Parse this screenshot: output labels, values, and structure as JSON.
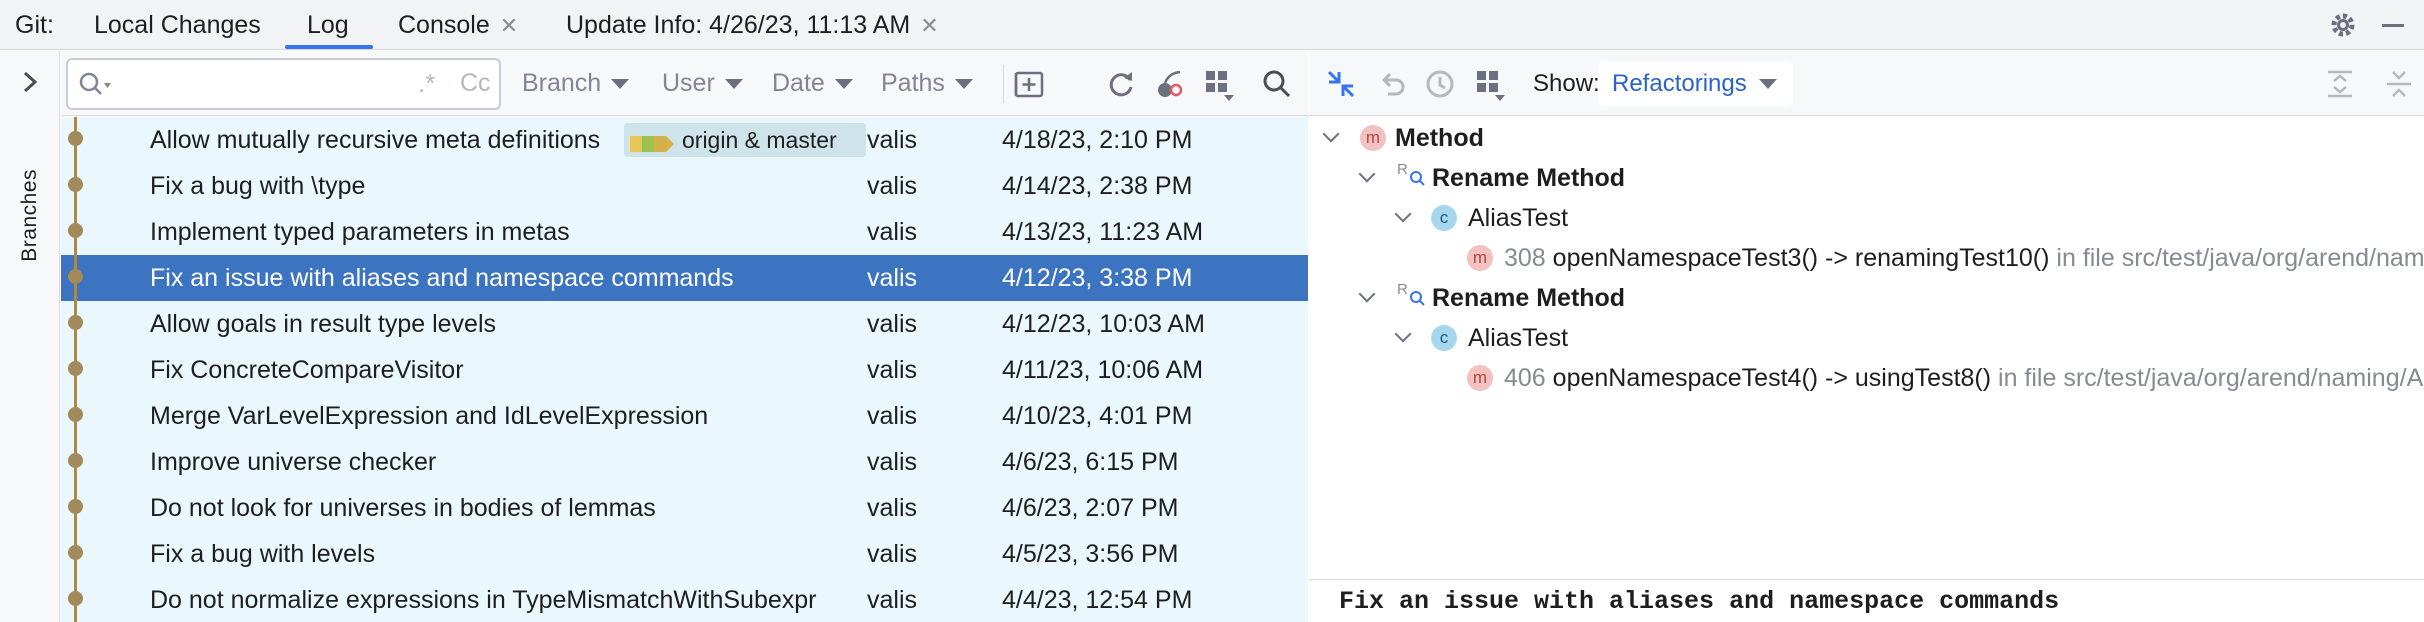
{
  "tabbar": {
    "git_label": "Git:",
    "tabs": [
      {
        "label": "Local Changes"
      },
      {
        "label": "Log"
      },
      {
        "label": "Console"
      },
      {
        "label": "Update Info: 4/26/23, 11:13 AM"
      }
    ],
    "active_tab": "Log"
  },
  "sidebar": {
    "branches_label": "Branches"
  },
  "log": {
    "search": {
      "value": "",
      "placeholder": ""
    },
    "filters": [
      {
        "label": "Branch"
      },
      {
        "label": "User"
      },
      {
        "label": "Date"
      },
      {
        "label": "Paths"
      }
    ],
    "ref_label": "origin & master",
    "commits": [
      {
        "subject": "Allow mutually recursive meta definitions",
        "author": "valis",
        "date": "4/18/23, 2:10 PM"
      },
      {
        "subject": "Fix a bug with \\type",
        "author": "valis",
        "date": "4/14/23, 2:38 PM"
      },
      {
        "subject": "Implement typed parameters in metas",
        "author": "valis",
        "date": "4/13/23, 11:23 AM"
      },
      {
        "subject": "Fix an issue with aliases and namespace commands",
        "author": "valis",
        "date": "4/12/23, 3:38 PM"
      },
      {
        "subject": "Allow goals in result type levels",
        "author": "valis",
        "date": "4/12/23, 10:03 AM"
      },
      {
        "subject": "Fix ConcreteCompareVisitor",
        "author": "valis",
        "date": "4/11/23, 10:06 AM"
      },
      {
        "subject": "Merge VarLevelExpression and IdLevelExpression",
        "author": "valis",
        "date": "4/10/23, 4:01 PM"
      },
      {
        "subject": "Improve universe checker",
        "author": "valis",
        "date": "4/6/23, 6:15 PM"
      },
      {
        "subject": "Do not look for universes in bodies of lemmas",
        "author": "valis",
        "date": "4/6/23, 2:07 PM"
      },
      {
        "subject": "Fix a bug with levels",
        "author": "valis",
        "date": "4/5/23, 3:56 PM"
      },
      {
        "subject": "Do not normalize expressions in TypeMismatchWithSubexpr",
        "author": "valis",
        "date": "4/4/23, 12:54 PM"
      }
    ],
    "selected_index": 3
  },
  "details": {
    "show_label": "Show:",
    "show_value": "Refactorings",
    "tree": {
      "root": "Method",
      "groups": [
        {
          "label": "Rename Method",
          "class": "AliasTest",
          "item": {
            "line": "308",
            "text": "openNamespaceTest3() -> renamingTest10()",
            "file": "in file src/test/java/org/arend/naming/AliasTest.java"
          }
        },
        {
          "label": "Rename Method",
          "class": "AliasTest",
          "item": {
            "line": "406",
            "text": "openNamespaceTest4() -> usingTest8()",
            "file": "in file src/test/java/org/arend/naming/AliasTest.java"
          }
        }
      ]
    },
    "commit_message": "Fix an issue with aliases and namespace commands"
  },
  "colors": {
    "accent": "#3574f0",
    "selection": "#3d74c1",
    "graph": "#a38a5a",
    "row_bg": "#eaf8fd"
  }
}
